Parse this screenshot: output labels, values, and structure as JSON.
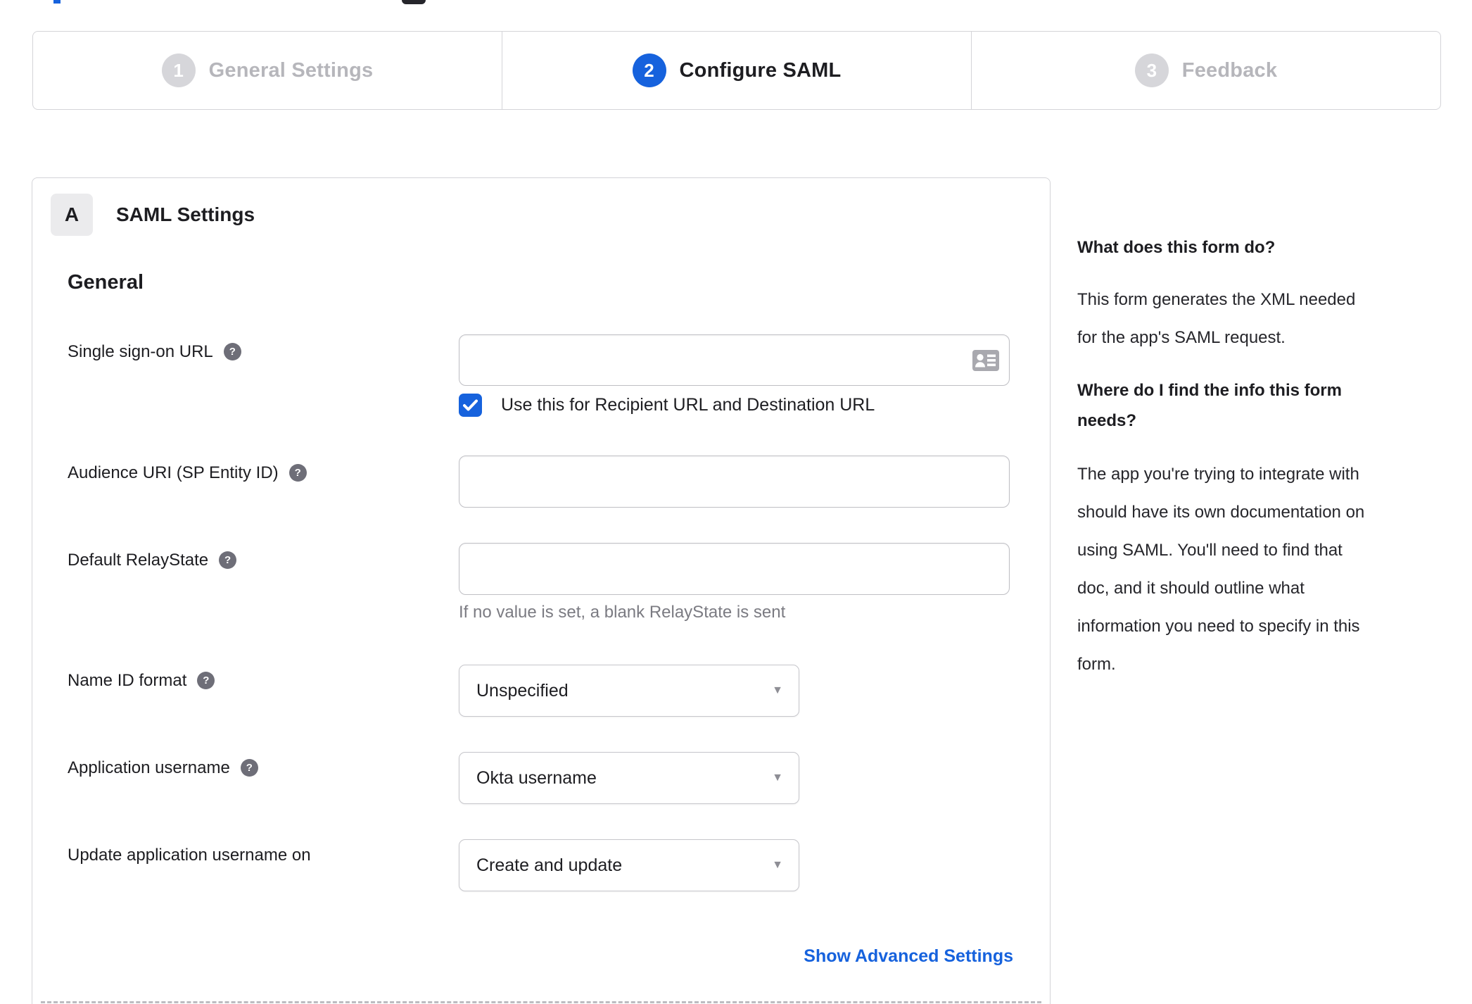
{
  "colors": {
    "accent": "#1662dd",
    "text": "#1d1d21",
    "muted_text": "#7b7b82",
    "border": "#d4d4d8",
    "inactive_step_circle": "#d6d6da",
    "inactive_step_label": "#b6b6bb",
    "badge_bg": "#ebebed",
    "help_icon_bg": "#6e6e78"
  },
  "icons": {
    "help": "?",
    "select_caret": "▼"
  },
  "stepper": {
    "steps": [
      {
        "number": "1",
        "label": "General Settings",
        "state": "inactive"
      },
      {
        "number": "2",
        "label": "Configure SAML",
        "state": "active"
      },
      {
        "number": "3",
        "label": "Feedback",
        "state": "inactive"
      }
    ]
  },
  "panel": {
    "badge": "A",
    "title": "SAML Settings",
    "section_title": "General"
  },
  "form": {
    "sso": {
      "label": "Single sign-on URL",
      "value": "",
      "checkbox_label": "Use this for Recipient URL and Destination URL",
      "checkbox_checked": true
    },
    "audience": {
      "label": "Audience URI (SP Entity ID)",
      "value": ""
    },
    "relay": {
      "label": "Default RelayState",
      "value": "",
      "hint": "If no value is set, a blank RelayState is sent"
    },
    "name_id": {
      "label": "Name ID format",
      "value": "Unspecified"
    },
    "app_username": {
      "label": "Application username",
      "value": "Okta username"
    },
    "update_username": {
      "label": "Update application username on",
      "value": "Create and update"
    },
    "advanced_link": "Show Advanced Settings"
  },
  "sidebar": {
    "q1": "What does this form do?",
    "a1": "This form generates the XML needed for the app's SAML request.",
    "a1_lines": [
      "This form generates the XML needed",
      "for the app's SAML request."
    ],
    "q2": "Where do I find the info this form needs?",
    "q2_lines": [
      "Where do I find the info this form",
      "needs?"
    ],
    "a2": "The app you're trying to integrate with should have its own documentation on using SAML. You'll need to find that doc, and it should outline what information you need to specify in this form.",
    "a2_lines": [
      "The app you're trying to integrate with",
      "should have its own documentation on",
      "using SAML. You'll need to find that",
      "doc, and it should outline what",
      "information you need to specify in this",
      "form."
    ]
  }
}
